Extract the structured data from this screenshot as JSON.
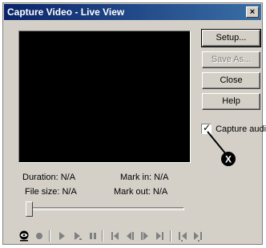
{
  "window": {
    "title": "Capture Video - Live View",
    "close_glyph": "×"
  },
  "buttons": {
    "setup": "Setup...",
    "save_as": "Save As...",
    "close": "Close",
    "help": "Help"
  },
  "capture_audio": {
    "label": "Capture audio",
    "checked": true,
    "check_glyph": "✓"
  },
  "callout": {
    "glyph": "X"
  },
  "info": {
    "duration": "Duration: N/A",
    "file_size": "File size: N/A",
    "mark_in": "Mark in: N/A",
    "mark_out": "Mark out: N/A"
  },
  "slider": {
    "position": 0
  },
  "toolbar_icons": [
    "record-eye-icon",
    "record-dot-icon",
    "play-icon",
    "play-to-end-icon",
    "pause-icon",
    "go-to-start-icon",
    "step-back-icon",
    "step-forward-icon",
    "go-to-end-icon",
    "mark-in-icon",
    "mark-out-icon"
  ]
}
